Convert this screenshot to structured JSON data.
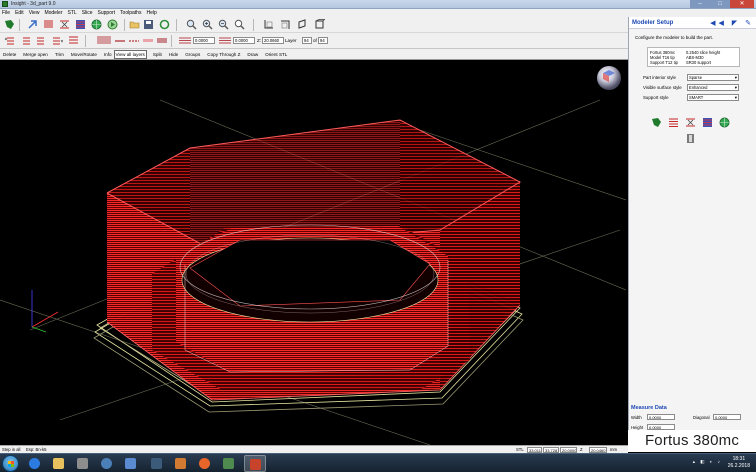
{
  "window": {
    "title": "Insight - 3d_part 9.0"
  },
  "menu": [
    "File",
    "Edit",
    "View",
    "Modeler",
    "STL",
    "Slice",
    "Support",
    "Toolpaths",
    "Help"
  ],
  "toolbar2": {
    "value_a": "0.0000",
    "value_b": "0.0000",
    "z_label": "Z:",
    "z_value": "20.0660",
    "layer_label": "Layer",
    "layer_value": "94",
    "of_label": "of",
    "of_value": "94"
  },
  "commands": [
    "Delete",
    "Merge open",
    "Trim",
    "Move/Rotate",
    "Info",
    "View all layers",
    "Split",
    "Hide",
    "Groups",
    "Copy Through Z",
    "Draw",
    "Orient STL"
  ],
  "commands_active": "View all layers",
  "panel": {
    "title": "Modeler Setup",
    "arrows": "◀◀ ◤ ✎",
    "description": "Configure the modeler to build the part.",
    "info": [
      {
        "left": "Fortus 380mc",
        "right": "0.2540 slice height"
      },
      {
        "left": "Model  T16 tip",
        "right": "ABS-M30"
      },
      {
        "left": "Support  T12 tip",
        "right": "SR30 support"
      }
    ],
    "styles": [
      {
        "label": "Part interior style",
        "value": "Sparse"
      },
      {
        "label": "Visible surface style",
        "value": "Enhanced"
      },
      {
        "label": "Support style",
        "value": "SMART"
      }
    ]
  },
  "measure": {
    "title": "Measure Data",
    "width_label": "Width",
    "width_value": "0.0000",
    "height_label": "Height",
    "height_value": "0.0000",
    "diagonal_label": "Diagonal",
    "diagonal_value": "0.0000"
  },
  "brand": "Fortus 380mc",
  "status": {
    "hint": "Step in all",
    "hint2": "Esp: Bn-k5",
    "stl_label": "STL",
    "stl_x": "33.0114",
    "stl_y": "33.7281",
    "stl_z": "20.0000",
    "z_label": "Z",
    "z_value": "20.0460",
    "units": "mm"
  },
  "taskbar": {
    "time": "18:31",
    "date": "26.2.2018"
  },
  "colors": {
    "viewport_bg": "#000000",
    "part_red": "#ff2020",
    "support_yellow": "#e8e6a0",
    "panel_title": "#1e48b4"
  }
}
